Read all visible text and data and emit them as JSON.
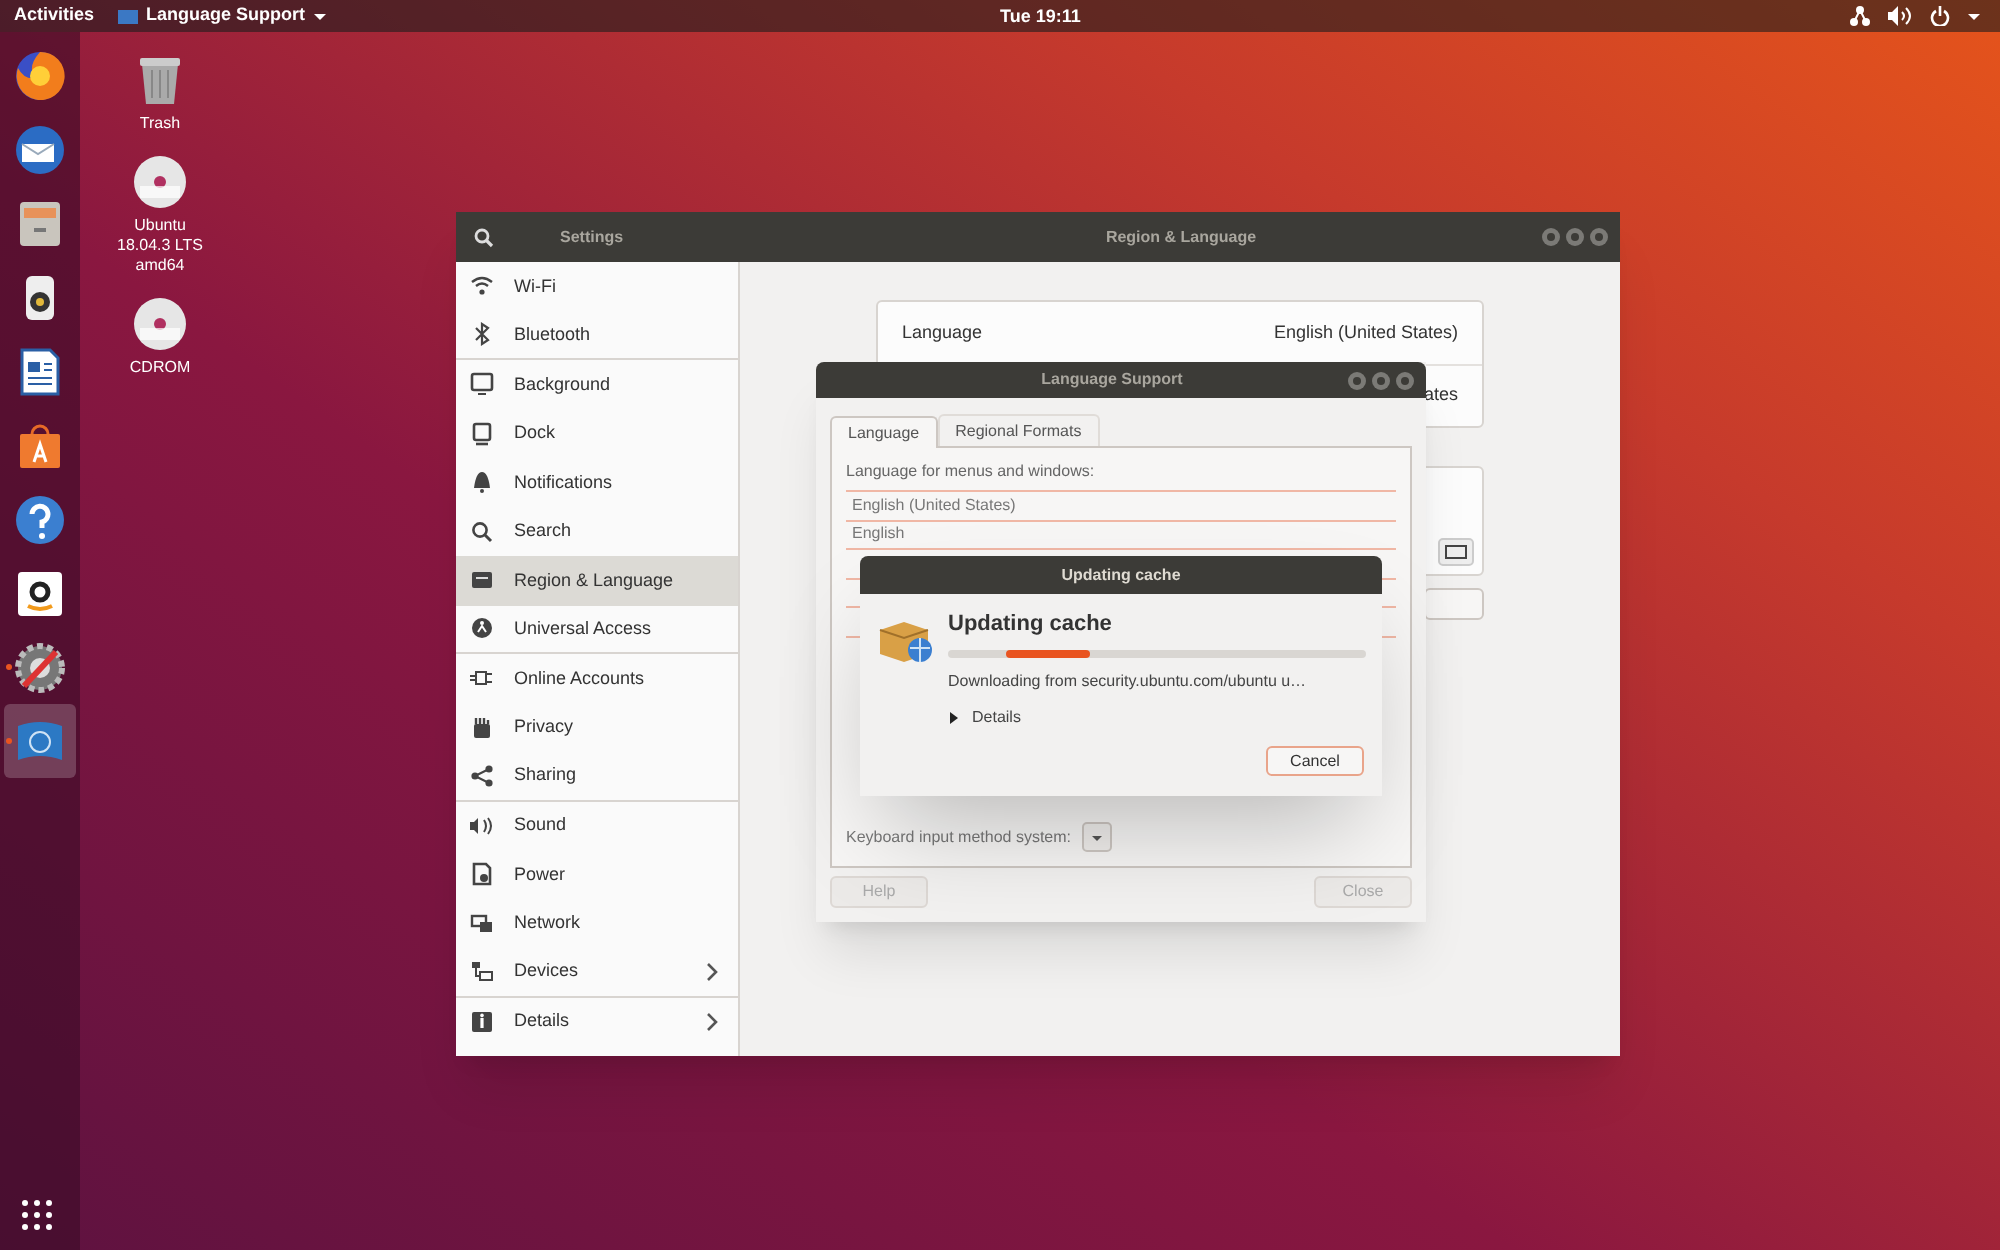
{
  "top_bar": {
    "activities": "Activities",
    "app_menu": "Language Support",
    "clock": "Tue 19:11"
  },
  "dock": [
    {
      "running": false,
      "selected": false
    },
    {
      "running": false,
      "selected": false
    },
    {
      "running": false,
      "selected": false
    },
    {
      "running": false,
      "selected": false
    },
    {
      "running": false,
      "selected": false
    },
    {
      "running": false,
      "selected": false
    },
    {
      "running": false,
      "selected": false
    },
    {
      "running": false,
      "selected": false
    },
    {
      "running": true,
      "selected": false
    },
    {
      "running": true,
      "selected": true
    }
  ],
  "desktop_icons": [
    {
      "kind": "trash",
      "lines": [
        "Trash"
      ]
    },
    {
      "kind": "disc",
      "lines": [
        "Ubuntu",
        "18.04.3 LTS",
        "amd64"
      ]
    },
    {
      "kind": "disc",
      "lines": [
        "CDROM"
      ]
    }
  ],
  "settings": {
    "sidebar_title": "Settings",
    "title": "Region & Language",
    "sidebar": [
      {
        "label": "Wi-Fi",
        "selected": false,
        "expandable": false,
        "group_end": false
      },
      {
        "label": "Bluetooth",
        "selected": false,
        "expandable": false,
        "group_end": true
      },
      {
        "label": "Background",
        "selected": false,
        "expandable": false,
        "group_end": false
      },
      {
        "label": "Dock",
        "selected": false,
        "expandable": false,
        "group_end": false
      },
      {
        "label": "Notifications",
        "selected": false,
        "expandable": false,
        "group_end": false
      },
      {
        "label": "Search",
        "selected": false,
        "expandable": false,
        "group_end": false
      },
      {
        "label": "Region & Language",
        "selected": true,
        "expandable": false,
        "group_end": false
      },
      {
        "label": "Universal Access",
        "selected": false,
        "expandable": false,
        "group_end": true
      },
      {
        "label": "Online Accounts",
        "selected": false,
        "expandable": false,
        "group_end": false
      },
      {
        "label": "Privacy",
        "selected": false,
        "expandable": false,
        "group_end": false
      },
      {
        "label": "Sharing",
        "selected": false,
        "expandable": false,
        "group_end": true
      },
      {
        "label": "Sound",
        "selected": false,
        "expandable": false,
        "group_end": false
      },
      {
        "label": "Power",
        "selected": false,
        "expandable": false,
        "group_end": false
      },
      {
        "label": "Network",
        "selected": false,
        "expandable": false,
        "group_end": false
      },
      {
        "label": "Devices",
        "selected": false,
        "expandable": true,
        "group_end": true
      },
      {
        "label": "Details",
        "selected": false,
        "expandable": true,
        "group_end": false
      }
    ],
    "rows": [
      {
        "label": "Language",
        "value": "English (United States)"
      },
      {
        "value": "ates"
      }
    ]
  },
  "language_support": {
    "title": "Language Support",
    "tabs": [
      {
        "label": "Language",
        "selected": true
      },
      {
        "label": "Regional Formats",
        "selected": false
      }
    ],
    "list_label": "Language for menus and windows:",
    "languages": [
      "English (United States)",
      "English"
    ],
    "input_method_label": "Keyboard input method system:",
    "buttons": [
      {
        "label": "Help",
        "disabled": true
      },
      {
        "label": "Close",
        "disabled": true
      }
    ]
  },
  "progress_dialog": {
    "title": "Updating cache",
    "heading": "Updating cache",
    "status": "Downloading from security.ubuntu.com/ubuntu u…",
    "details": {
      "label": "Details",
      "expanded": false
    },
    "button": "Cancel"
  }
}
